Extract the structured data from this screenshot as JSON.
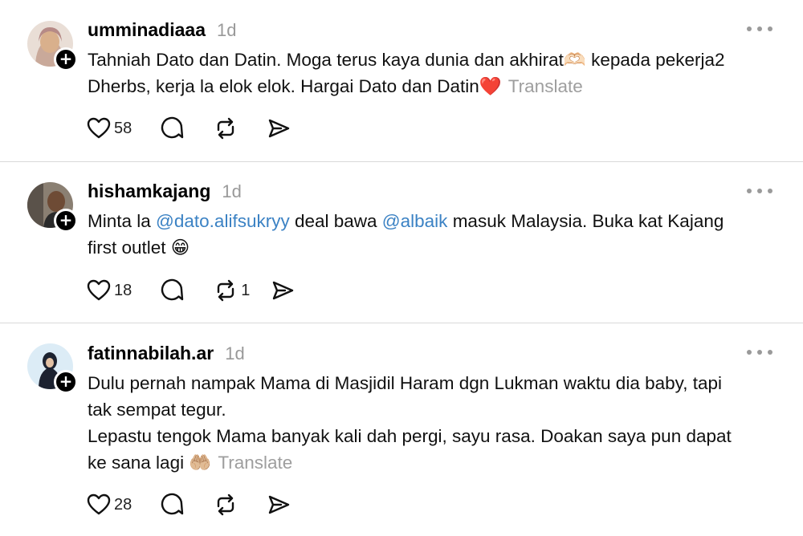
{
  "posts": [
    {
      "username": "umminadiaaa",
      "time": "1d",
      "lines": [
        "Tahniah Dato dan Datin. Moga terus kaya dunia dan akhirat🫶🏻 kepada pekerja2",
        "Dherbs, kerja la elok elok. Hargai Dato dan Datin❤️"
      ],
      "translate": "Translate",
      "likes": "58",
      "reposts": ""
    },
    {
      "username": "hishamkajang",
      "time": "1d",
      "line1_a": "Minta la ",
      "mention1": "@dato.alifsukryy",
      "line1_b": " deal bawa ",
      "mention2": "@albaik",
      "line1_c": " masuk Malaysia. Buka kat Kajang",
      "line2": "first outlet 😁",
      "likes": "18",
      "reposts": "1"
    },
    {
      "username": "fatinnabilah.ar",
      "time": "1d",
      "lines": [
        "Dulu pernah nampak Mama di Masjidil Haram dgn Lukman waktu dia baby, tapi",
        "tak sempat tegur.",
        "Lepastu tengok Mama banyak kali dah pergi, sayu rasa. Doakan saya pun dapat",
        "ke sana lagi 🤲🏼"
      ],
      "translate": "Translate",
      "likes": "28",
      "reposts": ""
    }
  ],
  "colors": {
    "mention": "#3b82c4",
    "muted": "#999999",
    "divider": "#d9d9d9"
  },
  "icons": [
    "heart-icon",
    "comment-icon",
    "repost-icon",
    "share-icon",
    "more-icon",
    "follow-plus-icon"
  ]
}
